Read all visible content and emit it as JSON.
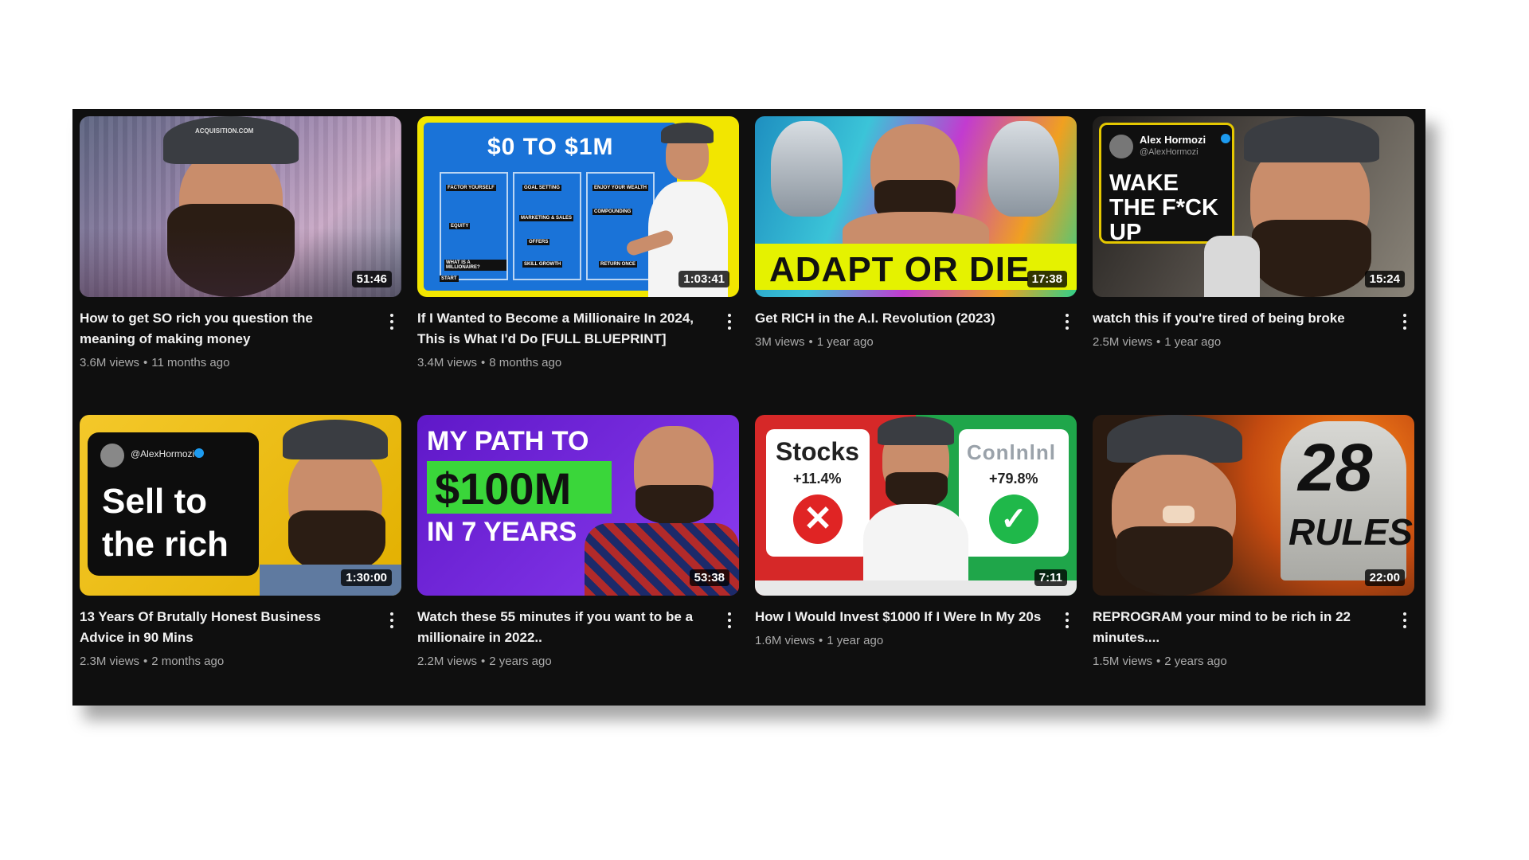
{
  "videos": [
    {
      "title": "How to get SO rich you question the meaning of making money",
      "views": "3.6M views",
      "age": "11 months ago",
      "duration": "51:46",
      "thumb": {
        "bg1": "#6a6f8a",
        "bg2": "#aa92b4",
        "cap_text": "ACQUISITION.COM"
      }
    },
    {
      "title": "If I Wanted to Become a Millionaire In 2024, This is What I'd Do [FULL BLUEPRINT]",
      "views": "3.4M views",
      "age": "8 months ago",
      "duration": "1:03:41",
      "thumb": {
        "bg1": "#1a73d8",
        "bg2": "#f2e600",
        "headline": "$0 TO $1M",
        "board_labels": [
          "START",
          "EQUITY",
          "WHAT IS A MILLIONAIRE?",
          "GOAL SETTING",
          "FACTOR YOURSELF",
          "MARKETING & SALES",
          "OFFERS",
          "SKILL GROWTH",
          "ENJOY YOUR WEALTH",
          "COMPOUNDING",
          "RETURN ONCE"
        ]
      }
    },
    {
      "title": "Get RICH in the A.I. Revolution (2023)",
      "views": "3M views",
      "age": "1 year ago",
      "duration": "17:38",
      "thumb": {
        "bg1": "#22a2c8",
        "bg2": "#e0f000",
        "banner": "ADAPT OR DIE"
      }
    },
    {
      "title": "watch this if you're tired of being broke",
      "views": "2.5M views",
      "age": "1 year ago",
      "duration": "15:24",
      "thumb": {
        "bg1": "#2c2a28",
        "bg2": "#8a8479",
        "name": "Alex Hormozi",
        "handle": "@AlexHormozi",
        "quote": "WAKE THE F*CK UP"
      }
    },
    {
      "title": "13 Years Of Brutally Honest Business Advice in 90 Mins",
      "views": "2.3M views",
      "age": "2 months ago",
      "duration": "1:30:00",
      "thumb": {
        "bg1": "#f0c020",
        "bg2": "#e9b800",
        "handle": "@AlexHormozi",
        "quote": "Sell to the rich"
      }
    },
    {
      "title": "Watch these 55 minutes if you want to be a millionaire in 2022..",
      "views": "2.2M views",
      "age": "2 years ago",
      "duration": "53:38",
      "thumb": {
        "bg1": "#6a1fd8",
        "bg2": "#8e3cf0",
        "line1": "MY PATH TO",
        "line2": "$100M",
        "line3": "IN 7 YEARS"
      }
    },
    {
      "title": "How I Would Invest $1000 If I Were In My 20s",
      "views": "1.6M views",
      "age": "1 year ago",
      "duration": "7:11",
      "thumb": {
        "bg1": "#d62828",
        "bg2": "#1fa64a",
        "left_label": "Stocks",
        "left_pct": "+11.4%",
        "right_label": "Conlnlnl",
        "right_pct": "+79.8%"
      }
    },
    {
      "title": "REPROGRAM your mind to be rich in 22 minutes....",
      "views": "1.5M views",
      "age": "2 years ago",
      "duration": "22:00",
      "thumb": {
        "bg1": "#3a2a1a",
        "bg2": "#d86a10",
        "number": "28",
        "word": "RULES"
      }
    }
  ],
  "separator": "•"
}
